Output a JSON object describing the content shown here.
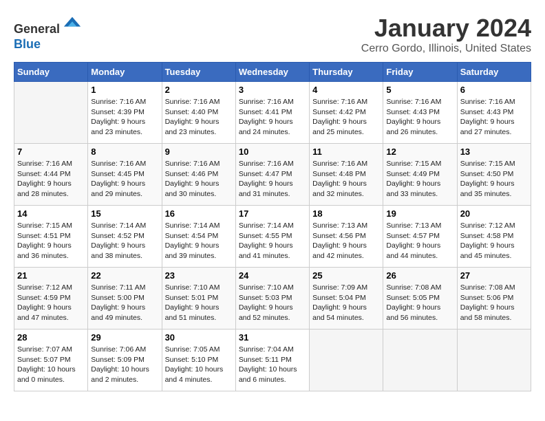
{
  "header": {
    "logo_line1": "General",
    "logo_line2": "Blue",
    "month": "January 2024",
    "location": "Cerro Gordo, Illinois, United States"
  },
  "weekdays": [
    "Sunday",
    "Monday",
    "Tuesday",
    "Wednesday",
    "Thursday",
    "Friday",
    "Saturday"
  ],
  "weeks": [
    [
      {
        "day": "",
        "content": ""
      },
      {
        "day": "1",
        "content": "Sunrise: 7:16 AM\nSunset: 4:39 PM\nDaylight: 9 hours\nand 23 minutes."
      },
      {
        "day": "2",
        "content": "Sunrise: 7:16 AM\nSunset: 4:40 PM\nDaylight: 9 hours\nand 23 minutes."
      },
      {
        "day": "3",
        "content": "Sunrise: 7:16 AM\nSunset: 4:41 PM\nDaylight: 9 hours\nand 24 minutes."
      },
      {
        "day": "4",
        "content": "Sunrise: 7:16 AM\nSunset: 4:42 PM\nDaylight: 9 hours\nand 25 minutes."
      },
      {
        "day": "5",
        "content": "Sunrise: 7:16 AM\nSunset: 4:43 PM\nDaylight: 9 hours\nand 26 minutes."
      },
      {
        "day": "6",
        "content": "Sunrise: 7:16 AM\nSunset: 4:43 PM\nDaylight: 9 hours\nand 27 minutes."
      }
    ],
    [
      {
        "day": "7",
        "content": "Sunrise: 7:16 AM\nSunset: 4:44 PM\nDaylight: 9 hours\nand 28 minutes."
      },
      {
        "day": "8",
        "content": "Sunrise: 7:16 AM\nSunset: 4:45 PM\nDaylight: 9 hours\nand 29 minutes."
      },
      {
        "day": "9",
        "content": "Sunrise: 7:16 AM\nSunset: 4:46 PM\nDaylight: 9 hours\nand 30 minutes."
      },
      {
        "day": "10",
        "content": "Sunrise: 7:16 AM\nSunset: 4:47 PM\nDaylight: 9 hours\nand 31 minutes."
      },
      {
        "day": "11",
        "content": "Sunrise: 7:16 AM\nSunset: 4:48 PM\nDaylight: 9 hours\nand 32 minutes."
      },
      {
        "day": "12",
        "content": "Sunrise: 7:15 AM\nSunset: 4:49 PM\nDaylight: 9 hours\nand 33 minutes."
      },
      {
        "day": "13",
        "content": "Sunrise: 7:15 AM\nSunset: 4:50 PM\nDaylight: 9 hours\nand 35 minutes."
      }
    ],
    [
      {
        "day": "14",
        "content": "Sunrise: 7:15 AM\nSunset: 4:51 PM\nDaylight: 9 hours\nand 36 minutes."
      },
      {
        "day": "15",
        "content": "Sunrise: 7:14 AM\nSunset: 4:52 PM\nDaylight: 9 hours\nand 38 minutes."
      },
      {
        "day": "16",
        "content": "Sunrise: 7:14 AM\nSunset: 4:54 PM\nDaylight: 9 hours\nand 39 minutes."
      },
      {
        "day": "17",
        "content": "Sunrise: 7:14 AM\nSunset: 4:55 PM\nDaylight: 9 hours\nand 41 minutes."
      },
      {
        "day": "18",
        "content": "Sunrise: 7:13 AM\nSunset: 4:56 PM\nDaylight: 9 hours\nand 42 minutes."
      },
      {
        "day": "19",
        "content": "Sunrise: 7:13 AM\nSunset: 4:57 PM\nDaylight: 9 hours\nand 44 minutes."
      },
      {
        "day": "20",
        "content": "Sunrise: 7:12 AM\nSunset: 4:58 PM\nDaylight: 9 hours\nand 45 minutes."
      }
    ],
    [
      {
        "day": "21",
        "content": "Sunrise: 7:12 AM\nSunset: 4:59 PM\nDaylight: 9 hours\nand 47 minutes."
      },
      {
        "day": "22",
        "content": "Sunrise: 7:11 AM\nSunset: 5:00 PM\nDaylight: 9 hours\nand 49 minutes."
      },
      {
        "day": "23",
        "content": "Sunrise: 7:10 AM\nSunset: 5:01 PM\nDaylight: 9 hours\nand 51 minutes."
      },
      {
        "day": "24",
        "content": "Sunrise: 7:10 AM\nSunset: 5:03 PM\nDaylight: 9 hours\nand 52 minutes."
      },
      {
        "day": "25",
        "content": "Sunrise: 7:09 AM\nSunset: 5:04 PM\nDaylight: 9 hours\nand 54 minutes."
      },
      {
        "day": "26",
        "content": "Sunrise: 7:08 AM\nSunset: 5:05 PM\nDaylight: 9 hours\nand 56 minutes."
      },
      {
        "day": "27",
        "content": "Sunrise: 7:08 AM\nSunset: 5:06 PM\nDaylight: 9 hours\nand 58 minutes."
      }
    ],
    [
      {
        "day": "28",
        "content": "Sunrise: 7:07 AM\nSunset: 5:07 PM\nDaylight: 10 hours\nand 0 minutes."
      },
      {
        "day": "29",
        "content": "Sunrise: 7:06 AM\nSunset: 5:09 PM\nDaylight: 10 hours\nand 2 minutes."
      },
      {
        "day": "30",
        "content": "Sunrise: 7:05 AM\nSunset: 5:10 PM\nDaylight: 10 hours\nand 4 minutes."
      },
      {
        "day": "31",
        "content": "Sunrise: 7:04 AM\nSunset: 5:11 PM\nDaylight: 10 hours\nand 6 minutes."
      },
      {
        "day": "",
        "content": ""
      },
      {
        "day": "",
        "content": ""
      },
      {
        "day": "",
        "content": ""
      }
    ]
  ]
}
